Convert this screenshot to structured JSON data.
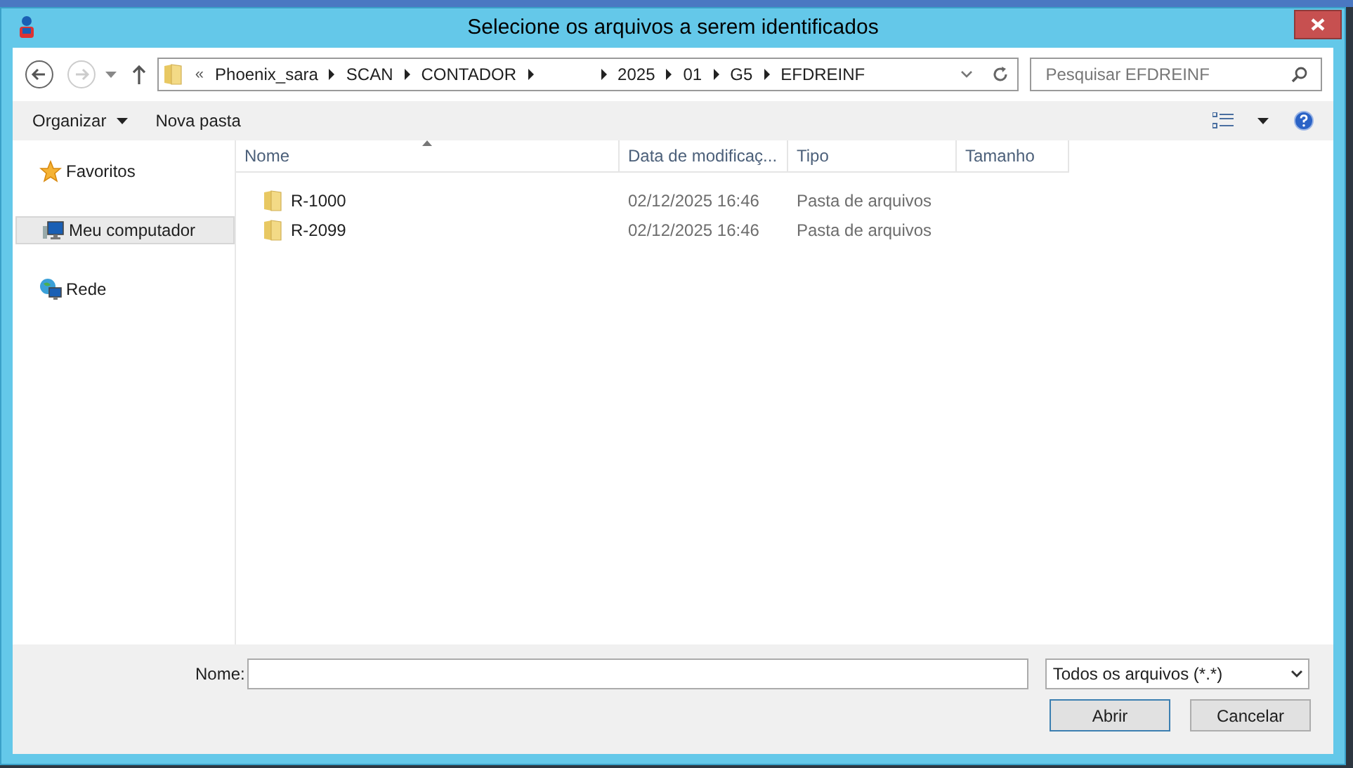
{
  "window": {
    "title": "Selecione os arquivos a serem identificados"
  },
  "address_bar": {
    "overflow": "«",
    "crumbs": [
      {
        "kind": "folder",
        "label": "Phoenix_sara"
      },
      {
        "kind": "folder",
        "label": "SCAN"
      },
      {
        "kind": "folder",
        "label": "CONTADOR"
      },
      {
        "kind": "gap"
      },
      {
        "kind": "folder",
        "label": "2025"
      },
      {
        "kind": "folder",
        "label": "01"
      },
      {
        "kind": "folder",
        "label": "G5"
      },
      {
        "kind": "folder",
        "label": "EFDREINF"
      }
    ]
  },
  "search": {
    "placeholder": "Pesquisar EFDREINF"
  },
  "toolbar": {
    "organize": "Organizar",
    "new_folder": "Nova pasta"
  },
  "sidebar": {
    "items": [
      {
        "kind": "favorites",
        "label": "Favoritos",
        "selected": false
      },
      {
        "kind": "computer",
        "label": "Meu computador",
        "selected": true
      },
      {
        "kind": "network",
        "label": "Rede",
        "selected": false
      }
    ]
  },
  "table": {
    "columns": [
      {
        "label": "Nome",
        "sorted": true
      },
      {
        "label": "Data de modificaç...",
        "sorted": false
      },
      {
        "label": "Tipo",
        "sorted": false
      },
      {
        "label": "Tamanho",
        "sorted": false
      }
    ],
    "rows": [
      {
        "name": "R-1000",
        "modified": "02/12/2025 16:46",
        "type": "Pasta de arquivos"
      },
      {
        "name": "R-2099",
        "modified": "02/12/2025 16:46",
        "type": "Pasta de arquivos"
      }
    ]
  },
  "footer": {
    "name_label": "Nome:",
    "filter": "Todos os arquivos (*.*)",
    "buttons": [
      {
        "label": "Abrir",
        "default": true
      },
      {
        "label": "Cancelar",
        "default": false
      }
    ]
  }
}
